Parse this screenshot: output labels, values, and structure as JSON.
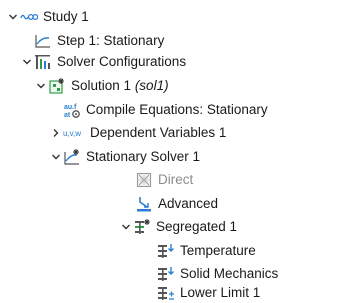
{
  "tree": {
    "study": {
      "label": "Study 1"
    },
    "step1": {
      "label": "Step 1: Stationary"
    },
    "solver_configs": {
      "label": "Solver Configurations"
    },
    "solution": {
      "label": "Solution 1",
      "tag": "(sol1)"
    },
    "compile": {
      "label": "Compile Equations: Stationary"
    },
    "dependent": {
      "label": "Dependent Variables 1",
      "icon_text": "u,v,w"
    },
    "stationary_solver": {
      "label": "Stationary Solver 1"
    },
    "direct": {
      "label": "Direct"
    },
    "advanced": {
      "label": "Advanced"
    },
    "segregated": {
      "label": "Segregated 1"
    },
    "temperature": {
      "label": "Temperature"
    },
    "solid_mechanics": {
      "label": "Solid Mechanics"
    },
    "lower_limit": {
      "label": "Lower Limit 1"
    }
  },
  "colors": {
    "accent_blue": "#2a7fd3",
    "icon_green": "#2e9e4a",
    "icon_gray": "#7a7a7a",
    "dim_text": "#8c8c8c"
  },
  "icons": {
    "study": "study-icon",
    "step": "stationary-step-icon",
    "solver_configs": "solver-configurations-icon",
    "solution": "solution-icon",
    "compile": "compile-equations-icon",
    "dependent": "dependent-variables-icon",
    "stationary_solver": "stationary-solver-icon",
    "direct": "direct-solver-icon",
    "advanced": "advanced-icon",
    "segregated": "segregated-icon",
    "segregated_step": "segregated-step-icon",
    "lower_limit": "lower-limit-icon"
  }
}
